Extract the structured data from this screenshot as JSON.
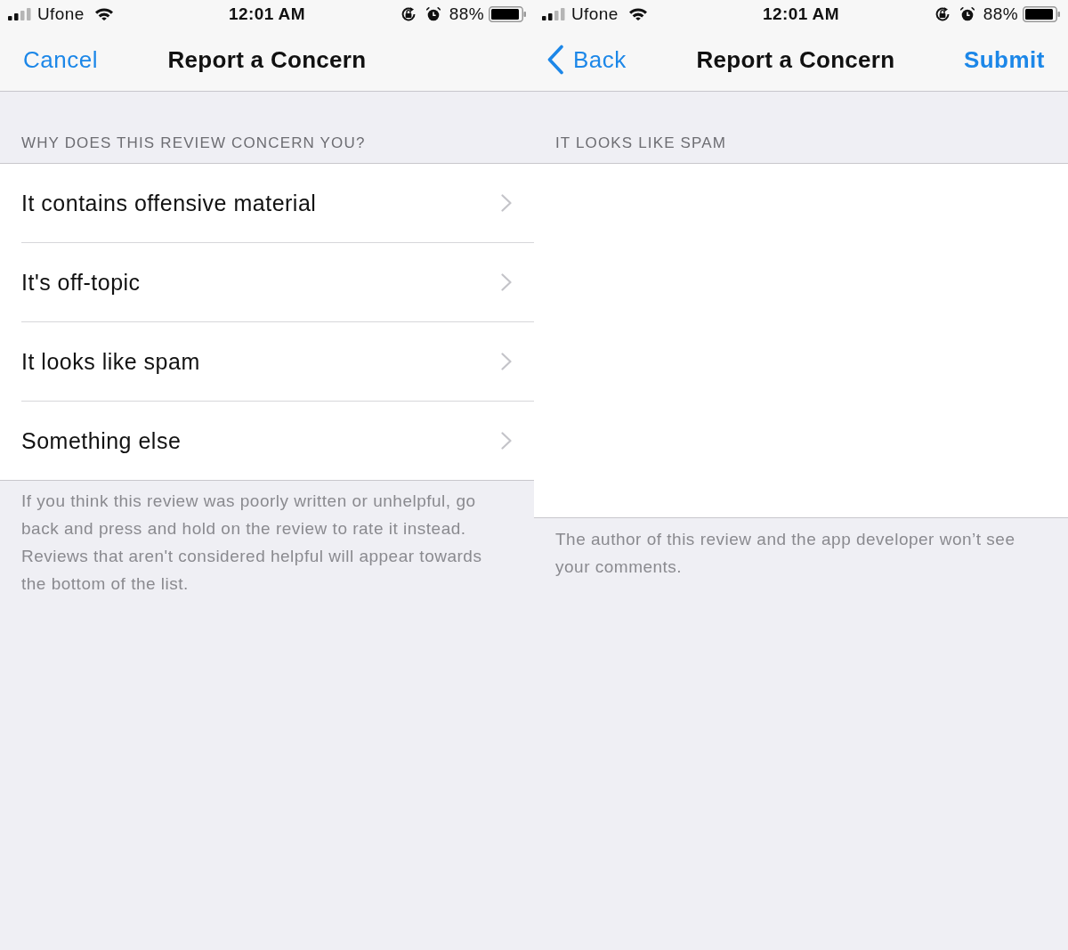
{
  "screens": [
    {
      "status_bar": {
        "carrier": "Ufone",
        "time": "12:01 AM",
        "battery": "88%"
      },
      "nav_bar": {
        "left": {
          "kind": "text",
          "label": "Cancel"
        },
        "title": "Report a Concern"
      },
      "section_header": "WHY DOES THIS REVIEW CONCERN YOU?",
      "content": {
        "kind": "options",
        "items": [
          "It contains offensive material",
          "It's off-topic",
          "It looks like spam",
          "Something else"
        ]
      },
      "footer": "If you think this review was poorly written or unhelpful, go back and press and hold on the review to rate it instead. Reviews that aren't considered helpful will appear towards the bottom of the list."
    },
    {
      "status_bar": {
        "carrier": "Ufone",
        "time": "12:01 AM",
        "battery": "88%"
      },
      "nav_bar": {
        "left": {
          "kind": "back",
          "label": "Back"
        },
        "title": "Report a Concern",
        "right": "Submit"
      },
      "section_header": "IT LOOKS LIKE SPAM",
      "content": {
        "kind": "comment_field"
      },
      "footer": "The author of this review and the app developer won’t see your comments."
    }
  ]
}
